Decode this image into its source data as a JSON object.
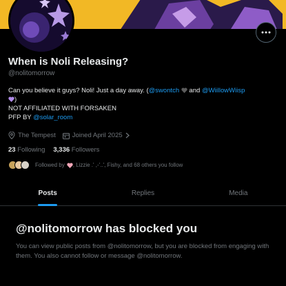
{
  "profile": {
    "name": "When is Noli Releasing?",
    "handle": "@nolitomorrow",
    "bio": {
      "line1_prefix": "Can you believe it guys? Noli! Just a day away. (",
      "mention1": "@swontch",
      "line1_and": " and ",
      "mention2": "@WiillowWiisp",
      "line1_close": ")",
      "line2": "NOT AFFILIATED WITH FORSAKEN",
      "line3_prefix": "PFP BY ",
      "mention3": "@solar_room"
    },
    "location": "The Tempest",
    "joined": "Joined April 2025",
    "following_count": "23",
    "following_label": "Following",
    "followers_count": "3,336",
    "followers_label": "Followers",
    "followed_by_prefix": "Followed by",
    "followed_by_rest": ", Lizzie .' ,-'..', Fishy, and 68 others you follow"
  },
  "tabs": [
    {
      "label": "Posts"
    },
    {
      "label": "Replies"
    },
    {
      "label": "Media"
    }
  ],
  "blocked": {
    "title": "@nolitomorrow has blocked you",
    "text": "You can view public posts from @nolitomorrow, but you are blocked from engaging with them. You also cannot follow or message @nolitomorrow."
  },
  "colors": {
    "accent": "#1d9bf0",
    "banner": "#f2b825",
    "muted": "#71767b"
  },
  "icons": [
    "more-icon",
    "location-icon",
    "calendar-icon",
    "chevron-right-icon",
    "heart-icon"
  ]
}
